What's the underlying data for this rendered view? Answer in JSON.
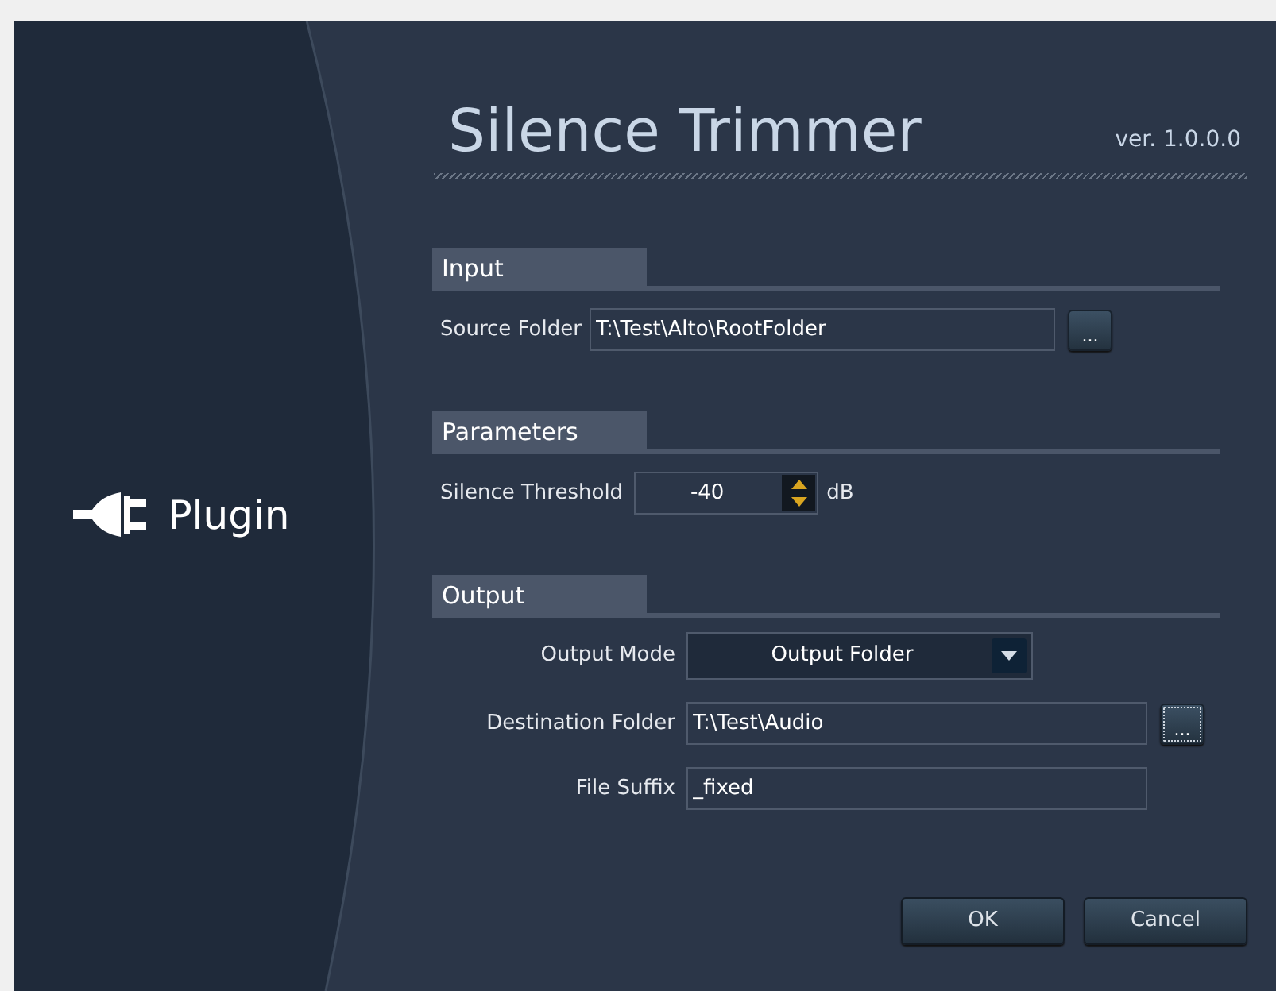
{
  "app": {
    "title": "Silence Trimmer",
    "version": "ver. 1.0.0.0",
    "brand": "Plugin"
  },
  "sections": [
    {
      "title": "Input",
      "kind": "inline",
      "fields": [
        {
          "kind": "folder",
          "label": "Source Folder",
          "value": "T:\\Test\\Alto\\RootFolder",
          "browse": "...",
          "focused": false
        }
      ]
    },
    {
      "title": "Parameters",
      "kind": "inline",
      "fields": [
        {
          "kind": "spin",
          "label": "Silence Threshold",
          "value": "-40",
          "unit": "dB"
        }
      ]
    },
    {
      "title": "Output",
      "kind": "grid",
      "fields": [
        {
          "kind": "select",
          "label": "Output Mode",
          "value": "Output Folder"
        },
        {
          "kind": "folder",
          "label": "Destination Folder",
          "value": "T:\\Test\\Audio",
          "browse": "...",
          "focused": true
        },
        {
          "kind": "text",
          "label": "File Suffix",
          "value": "_fixed"
        }
      ]
    }
  ],
  "buttons": [
    "OK",
    "Cancel"
  ]
}
